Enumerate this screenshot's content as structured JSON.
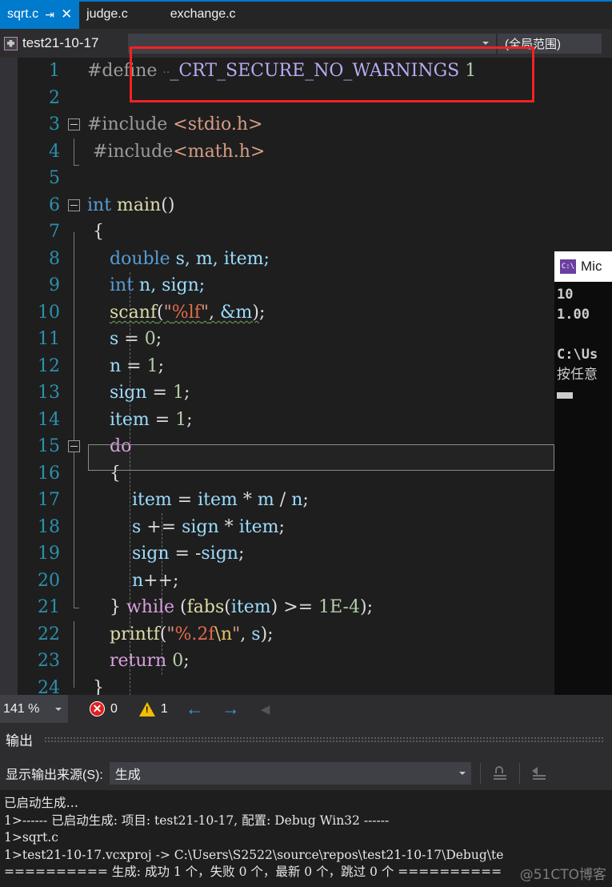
{
  "tabs": [
    {
      "label": "sqrt.c",
      "active": true,
      "pin_icon": "pin-icon",
      "close_icon": "close-icon"
    },
    {
      "label": "judge.c",
      "active": false
    },
    {
      "label": "exchange.c",
      "active": false
    }
  ],
  "navbar": {
    "project": "test21-10-17",
    "project_icon": "project-icon",
    "member_combo_value": "",
    "scope_combo_value": "(全局范围)",
    "dropdown_icon": "chevron-down-icon"
  },
  "editor": {
    "zoom_level": "141 %",
    "error_count": "0",
    "warning_count": "1",
    "error_icon": "error-circle-icon",
    "warning_icon": "warning-triangle-icon",
    "prev_icon": "arrow-left-icon",
    "next_icon": "arrow-right-icon",
    "collapse_icon": "arrow-left-small-icon",
    "current_line": 13,
    "lines": [
      {
        "n": "1",
        "text": "    #define _CRT_SECURE_NO_WARNINGS 1"
      },
      {
        "n": "2",
        "text": ""
      },
      {
        "n": "3",
        "text": "#include <stdio.h>"
      },
      {
        "n": "4",
        "text": " #include<math.h>"
      },
      {
        "n": "5",
        "text": ""
      },
      {
        "n": "6",
        "text": "int main()"
      },
      {
        "n": "7",
        "text": " {"
      },
      {
        "n": "8",
        "text": "     double s, m, item;"
      },
      {
        "n": "9",
        "text": "     int n, sign;"
      },
      {
        "n": "10",
        "text": "     scanf(\"%lf\", &m);"
      },
      {
        "n": "11",
        "text": "     s = 0;"
      },
      {
        "n": "12",
        "text": "     n = 1;"
      },
      {
        "n": "13",
        "text": "     sign = 1;"
      },
      {
        "n": "14",
        "text": "     item = 1;"
      },
      {
        "n": "15",
        "text": "     do"
      },
      {
        "n": "16",
        "text": "     {"
      },
      {
        "n": "17",
        "text": "         item = item * m / n;"
      },
      {
        "n": "18",
        "text": "         s += sign * item;"
      },
      {
        "n": "19",
        "text": "         sign = -sign;"
      },
      {
        "n": "20",
        "text": "         n++;"
      },
      {
        "n": "21",
        "text": "     } while (fabs(item) >= 1E-4);"
      },
      {
        "n": "22",
        "text": "     printf(\"%.2f\\n\", s);"
      },
      {
        "n": "23",
        "text": "     return 0;"
      },
      {
        "n": "24",
        "text": " }"
      }
    ],
    "tokens": {
      "l1_hash": "#define",
      "l1_macro": "_CRT_SECURE_NO_WARNINGS",
      "l1_val": "1",
      "l3_hash": "#include",
      "l3_hdr": "<stdio.h>",
      "l4_hash": "#include",
      "l4_hdr": "<math.h>",
      "l6_kw": "int",
      "l6_fn": "main",
      "l6_paren": "()",
      "l7": "{",
      "l8_kw": "double",
      "l8_rest": " s, m, item;",
      "l9_kw": "int",
      "l9_rest": " n, sign;",
      "l10_fn": "scanf",
      "l10_str": "\"%lf\"",
      "l10_fmt": "%lf",
      "l10_arg": "&m",
      "l11": "s = 0;",
      "l12": "n = 1;",
      "l13": "sign = 1;",
      "l14": "item = 1;",
      "l15_ctl": "do",
      "l16": "{",
      "l17": "item = item * m / n;",
      "l18": "s += sign * item;",
      "l19": "sign = -sign;",
      "l20": "n++;",
      "l21_ctl": "while",
      "l21_fn": "fabs",
      "l21_num": "1E-4",
      "l22_fn": "printf",
      "l22_str": "\"%.2f\\n\"",
      "l23_ctl": "return",
      "l23_num": "0",
      "l24": "}"
    }
  },
  "output": {
    "title": "输出",
    "source_label": "显示输出来源(S):",
    "source_value": "生成",
    "dropdown_icon": "chevron-down-icon",
    "clear_icon": "clear-output-icon",
    "wrap_icon": "word-wrap-icon",
    "lines": [
      "已启动生成…",
      "1>------ 已启动生成: 项目: test21-10-17, 配置: Debug Win32 ------",
      "1>sqrt.c",
      "1>test21-10-17.vcxproj -> C:\\Users\\S2522\\source\\repos\\test21-10-17\\Debug\\te",
      "========== 生成: 成功 1 个，失败 0 个，最新 0 个，跳过 0 个 =========="
    ]
  },
  "console": {
    "icon": "cmd-icon",
    "title": "Mic",
    "lines": [
      "10",
      "1.00",
      "",
      "C:\\Us",
      "按任意"
    ]
  },
  "watermark": "@51CTO博客",
  "colors": {
    "accent": "#007acc",
    "annotation_red": "#f42222",
    "editor_bg": "#1e1e1e",
    "chrome_bg": "#2d2d30",
    "line_number": "#2b91af"
  }
}
